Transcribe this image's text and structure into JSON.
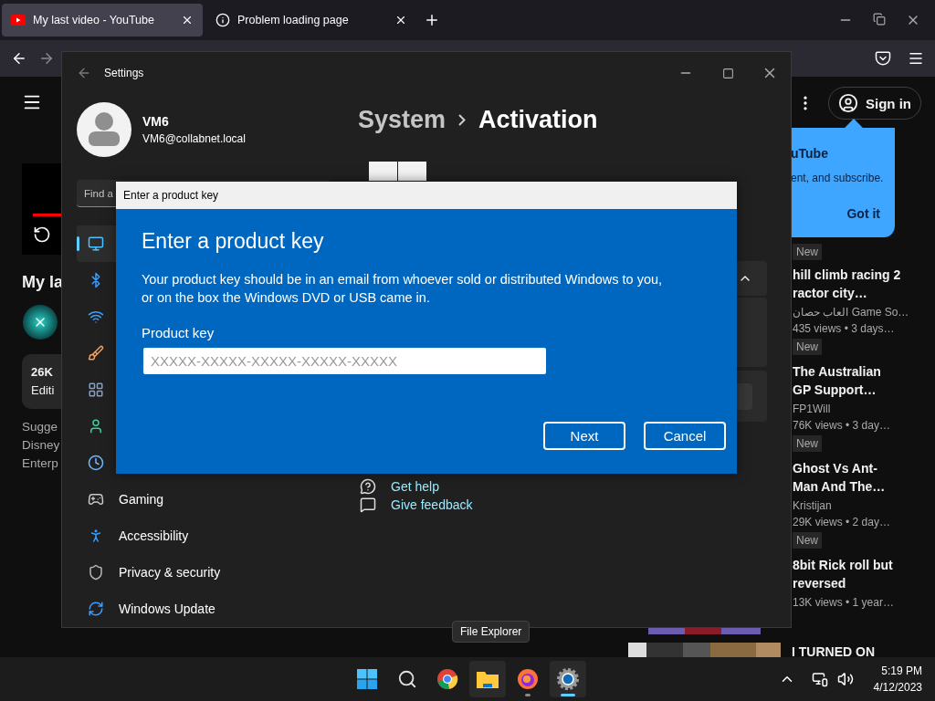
{
  "browser": {
    "tabs": [
      {
        "title": "My last video - YouTube",
        "selected": true
      },
      {
        "title": "Problem loading page",
        "selected": false
      }
    ]
  },
  "youtube": {
    "video_title": "My la",
    "stats": [
      "26K",
      "Editi"
    ],
    "description": [
      "Sugge",
      "Disney",
      "Enterp"
    ],
    "sign_in": "Sign in",
    "popup": {
      "title": "uTube",
      "text": "ent, and subscribe.",
      "button": "Got it"
    },
    "top_badge": "New",
    "videos": [
      {
        "title": [
          "hill climb racing 2",
          "ractor city…"
        ],
        "channel": "العاب حصان Game So…",
        "meta": "435 views  • 3 days…",
        "badge": "New"
      },
      {
        "title": [
          "The Australian",
          "GP Support…"
        ],
        "channel": "FP1Will",
        "meta": "76K views  • 3 day…",
        "badge": "New"
      },
      {
        "title": [
          "Ghost Vs Ant-",
          "Man And The…"
        ],
        "channel": "Kristijan",
        "meta": "29K views  • 2 day…",
        "badge": "New"
      },
      {
        "title": [
          "8bit Rick roll but",
          "reversed"
        ],
        "meta": "13K views  • 1 year…"
      }
    ],
    "last_title": "I TURNED ON"
  },
  "settings": {
    "title": "Settings",
    "user": {
      "name": "VM6",
      "email": "VM6@collabnet.local"
    },
    "search": {
      "placeholder": "Find a"
    },
    "nav": [
      {
        "selected": true
      },
      {
        "selected": false
      },
      {
        "selected": false
      },
      {
        "selected": false
      },
      {
        "selected": false
      },
      {
        "selected": false
      },
      {
        "selected": false
      },
      {
        "label": "Gaming",
        "selected": false
      },
      {
        "label": "Accessibility",
        "selected": false
      },
      {
        "label": "Privacy & security",
        "selected": false
      },
      {
        "label": "Windows Update",
        "selected": false
      }
    ],
    "breadcrumb": {
      "parent": "System",
      "current": "Activation"
    },
    "links": [
      "Get help",
      "Give feedback"
    ]
  },
  "dialog": {
    "title": "Enter a product key",
    "heading": "Enter a product key",
    "text_lines": [
      "Your product key should be in an email from whoever sold or distributed Windows to you,",
      "or on the box the Windows DVD or USB came in."
    ],
    "field_label": "Product key",
    "placeholder": "XXXXX-XXXXX-XXXXX-XXXXX-XXXXX",
    "buttons": [
      "Next",
      "Cancel"
    ]
  },
  "tooltip": "File Explorer",
  "taskbar": {
    "apps": [
      {
        "kind": "start",
        "running": false,
        "active": false,
        "hovered": false
      },
      {
        "kind": "search",
        "running": false,
        "active": false,
        "hovered": false
      },
      {
        "kind": "chrome",
        "running": false,
        "active": false,
        "hovered": false
      },
      {
        "kind": "explorer",
        "running": false,
        "active": false,
        "hovered": true
      },
      {
        "kind": "firefox",
        "running": true,
        "active": false,
        "hovered": false
      },
      {
        "kind": "settings",
        "running": true,
        "active": true,
        "hovered": true
      }
    ],
    "time": "5:19 PM",
    "date": "4/12/2023"
  }
}
